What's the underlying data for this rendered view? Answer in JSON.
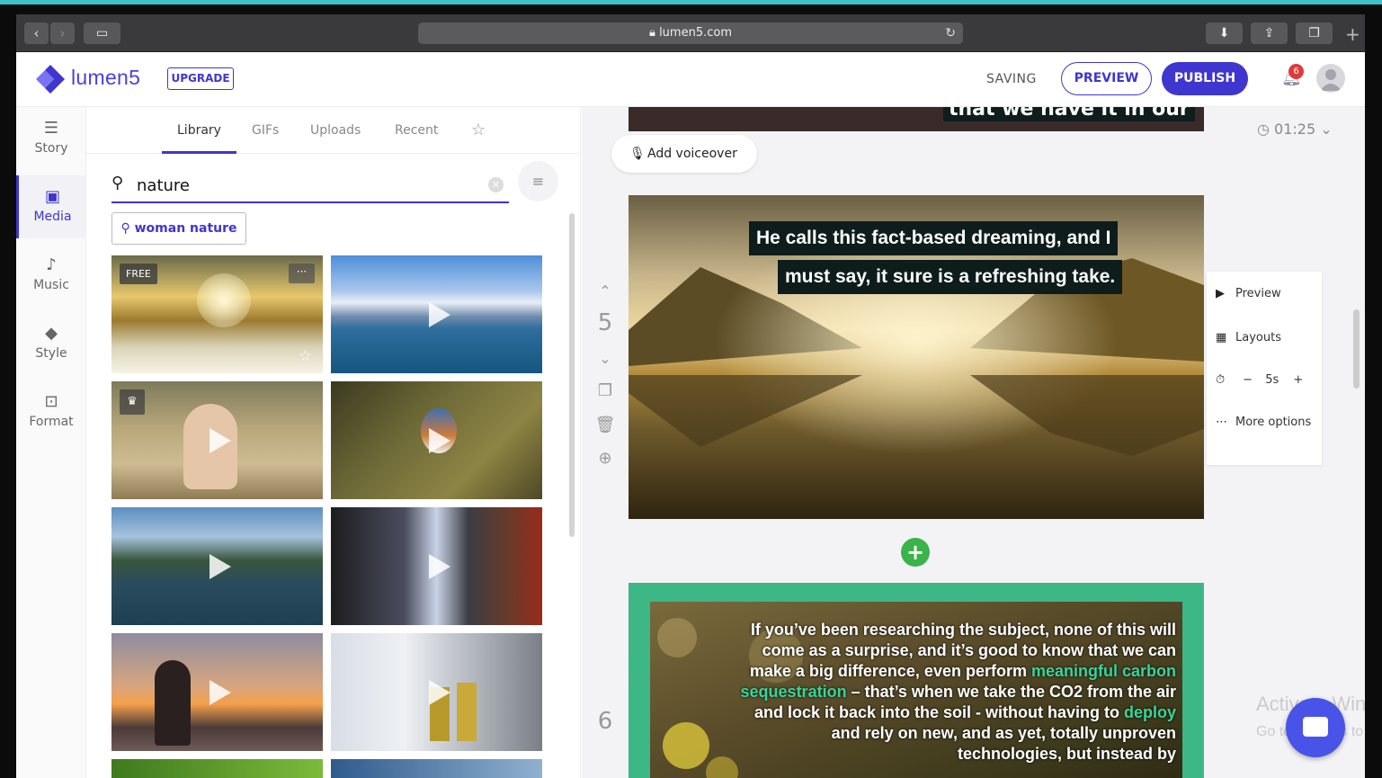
{
  "browser": {
    "url": "lumen5.com",
    "back_icon": "‹",
    "forward_icon": "›"
  },
  "header": {
    "brand": "lumen5",
    "upgrade": "UPGRADE",
    "status": "SAVING",
    "preview": "PREVIEW",
    "publish": "PUBLISH",
    "notifications_count": "6"
  },
  "nav": {
    "items": [
      {
        "label": "Story",
        "icon": "story-icon"
      },
      {
        "label": "Media",
        "icon": "image-icon"
      },
      {
        "label": "Music",
        "icon": "music-note-icon"
      },
      {
        "label": "Style",
        "icon": "style-icon"
      },
      {
        "label": "Format",
        "icon": "format-icon"
      }
    ]
  },
  "panel": {
    "tabs": [
      "Library",
      "GIFs",
      "Uploads",
      "Recent"
    ],
    "search_value": "nature",
    "suggestion": "woman nature",
    "free_tag": "FREE"
  },
  "editor": {
    "voiceover": "Add voiceover",
    "duration": "01:25",
    "prev_caption": "that we have it in our",
    "scene5": {
      "number": "5",
      "caption_line1": "He calls this fact-based dreaming, and I",
      "caption_line2": "must say, it sure is a refreshing take."
    },
    "scene_menu": {
      "preview": "Preview",
      "layouts": "Layouts",
      "duration": "5s",
      "minus": "−",
      "plus": "+",
      "more": "More options"
    },
    "scene6": {
      "number": "6",
      "t1": "If you’ve been researching the subject, none of this will come as a surprise, and it’s good to know that we can make a big difference, even perform ",
      "highlight1": "meaningful carbon sequestration",
      "t2": " – that’s when we take the CO2 from the air and lock it back into the soil - without having to ",
      "highlight2": "deploy",
      "t3": " and rely on new, and as yet, totally unproven technologies, but instead by"
    }
  },
  "os_watermark": {
    "line1": "Activate Win",
    "line2": "Go to Settings to"
  }
}
